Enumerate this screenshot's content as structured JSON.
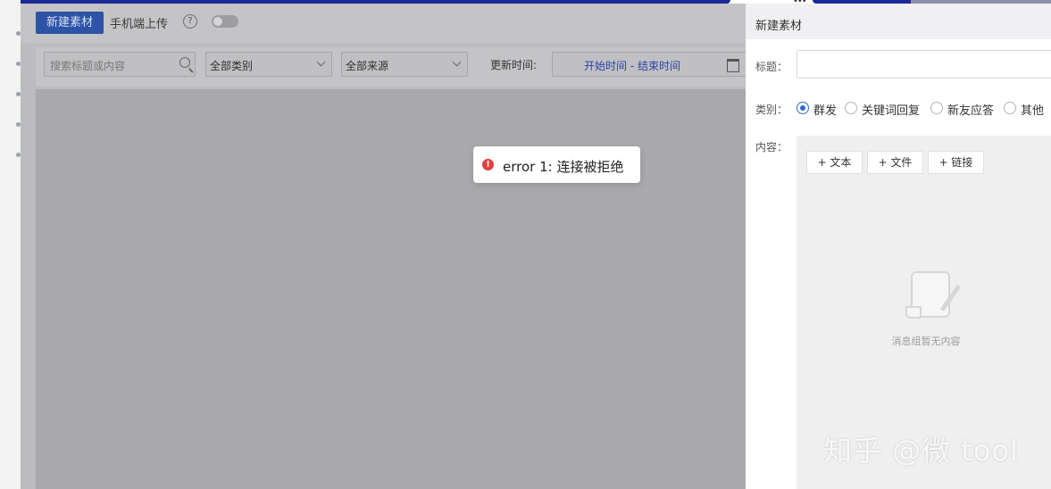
{
  "toolbar": {
    "new_button": "新建素材",
    "mobile_upload_label": "手机端上传",
    "help_icon": "?"
  },
  "filters": {
    "search_placeholder": "搜索标题或内容",
    "category_selected": "全部类别",
    "source_selected": "全部来源",
    "update_time_label": "更新时间:",
    "date_range": "开始时间 - 结束时间"
  },
  "toast": {
    "icon": "!",
    "message": "error 1: 连接被拒绝"
  },
  "panel": {
    "title": "新建素材",
    "title_label": "标题：",
    "category_label": "类别：",
    "categories": [
      "群发",
      "关键词回复",
      "新友应答",
      "其他"
    ],
    "selected_category": "群发",
    "content_label": "内容：",
    "add_buttons": [
      "+ 文本",
      "+ 文件",
      "+ 链接"
    ],
    "empty_message": "消息组暂无内容"
  },
  "watermark": "知乎 @微 tool",
  "colors": {
    "primary_blue": "#2c53a6",
    "error_red": "#e23e3e",
    "top_bar": "#1d2a96"
  }
}
